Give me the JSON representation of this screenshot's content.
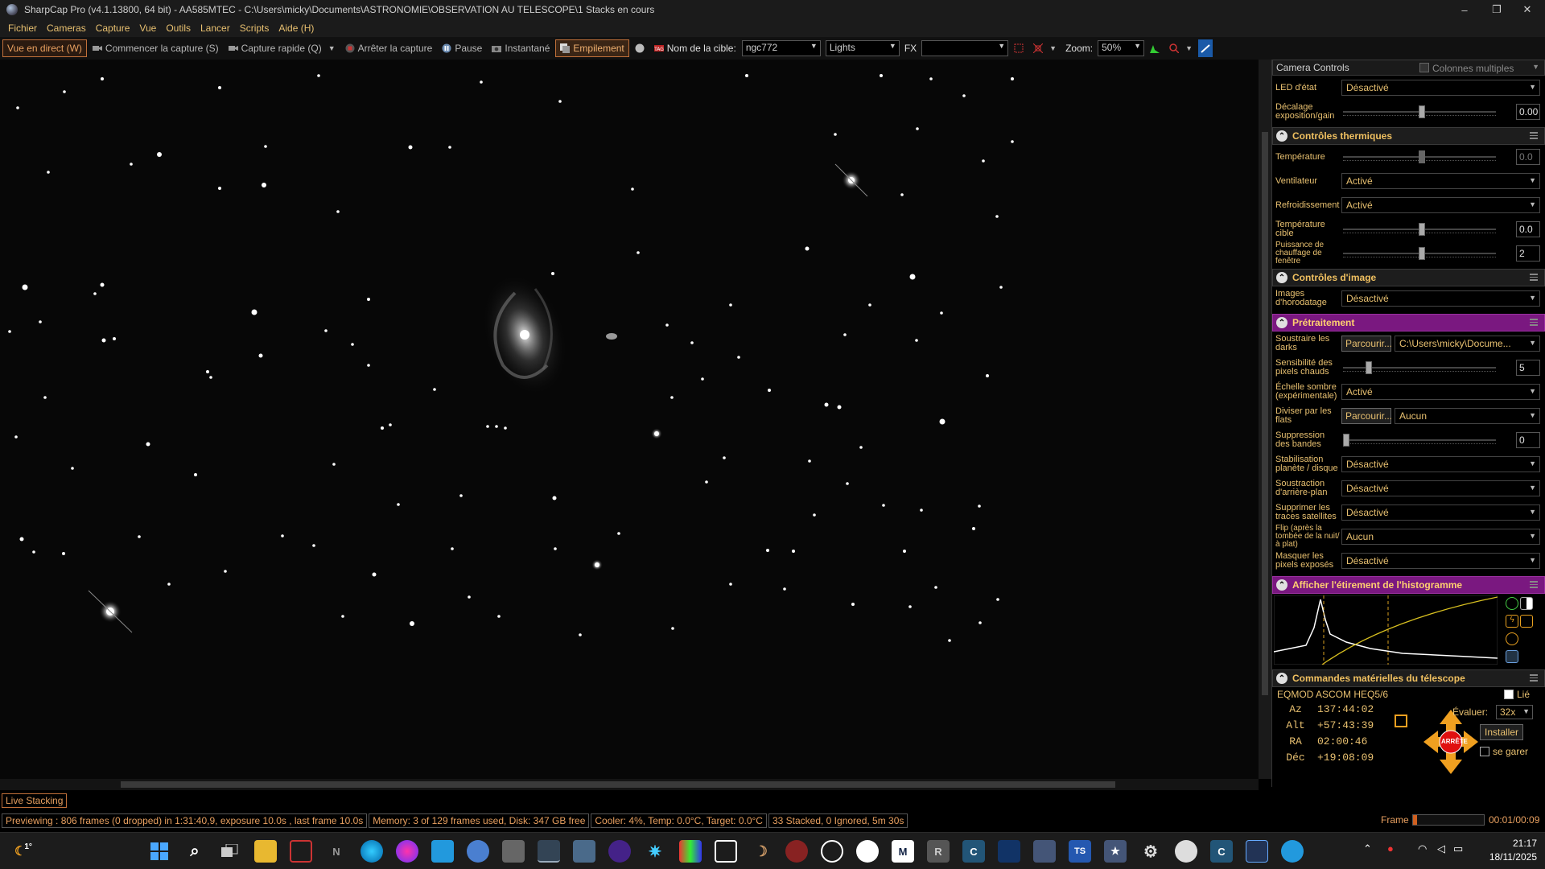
{
  "window": {
    "title": "SharpCap Pro (v4.1.13800, 64 bit) - AA585MTEC - C:\\Users\\micky\\Documents\\ASTRONOMIE\\OBSERVATION AU TELESCOPE\\1 Stacks en cours",
    "minimize": "–",
    "maximize": "❐",
    "close": "✕"
  },
  "menu": [
    "Fichier",
    "Cameras",
    "Capture",
    "Vue",
    "Outils",
    "Lancer",
    "Scripts",
    "Aide (H)"
  ],
  "toolbar": {
    "live_view": "Vue en direct (W)",
    "start_capture": "Commencer la capture (S)",
    "quick_capture": "Capture rapide (Q)",
    "stop_capture": "Arrêter la capture",
    "pause": "Pause",
    "snapshot": "Instantané",
    "stacking": "Empilement",
    "target_label": "Nom de la cible:",
    "target_value": "ngc772",
    "frame_type": "Lights",
    "fx_label": "FX",
    "fx_value": "",
    "zoom_label": "Zoom:",
    "zoom_value": "50%"
  },
  "panel": {
    "header": "Camera Controls",
    "multi_columns": "Colonnes multiples",
    "top_rows": [
      {
        "label": "LED d'état",
        "value": "Désactivé"
      },
      {
        "label": "Décalage exposition/gain",
        "value": "0.00"
      }
    ],
    "thermal": {
      "title": "Contrôles thermiques",
      "temperature": {
        "label": "Température",
        "value": "0.0"
      },
      "fan": {
        "label": "Ventilateur",
        "value": "Activé"
      },
      "cooling": {
        "label": "Refroidissement",
        "value": "Activé"
      },
      "target_temp": {
        "label": "Température cible",
        "value": "0.0"
      },
      "heater": {
        "label": "Puissance de chauffage de fenêtre",
        "value": "2"
      }
    },
    "image": {
      "title": "Contrôles d'image",
      "timestamp": {
        "label": "Images d'horodatage",
        "value": "Désactivé"
      }
    },
    "preprocessing": {
      "title": "Prétraitement",
      "darks": {
        "label": "Soustraire les darks",
        "browse": "Parcourir...",
        "value": "C:\\Users\\micky\\Docume..."
      },
      "hot_pixels": {
        "label": "Sensibilité des pixels chauds",
        "value": "5"
      },
      "dark_scale": {
        "label": "Échelle sombre (expérimentale)",
        "value": "Activé"
      },
      "flats": {
        "label": "Diviser par les flats",
        "browse": "Parcourir...",
        "value": "Aucun"
      },
      "banding": {
        "label": "Suppression des bandes",
        "value": "0"
      },
      "stabilization": {
        "label": "Stabilisation planète / disque",
        "value": "Désactivé"
      },
      "background": {
        "label": "Soustraction d'arrière-plan",
        "value": "Désactivé"
      },
      "satellites": {
        "label": "Supprimer les traces satellites",
        "value": "Désactivé"
      },
      "flip": {
        "label": "Flip (après la tombée de la nuit/à plat)",
        "value": "Aucun"
      },
      "overexposed": {
        "label": "Masquer les pixels exposés",
        "value": "Désactivé"
      }
    },
    "histogram": {
      "title": "Afficher l'étirement de l'histogramme"
    },
    "telescope": {
      "title": "Commandes matérielles du télescope",
      "mount": "EQMOD ASCOM HEQ5/6",
      "linked": "Lié",
      "rows": [
        {
          "label": "Az",
          "value": "137:44:02"
        },
        {
          "label": "Alt",
          "value": "+57:43:39"
        },
        {
          "label": "RA",
          "value": "02:00:46"
        },
        {
          "label": "Déc",
          "value": "+19:08:09"
        }
      ],
      "rate_label": "Évaluer:",
      "rate_value": "32x",
      "install": "Installer",
      "stop": "ARRÊTE",
      "park": "se garer"
    }
  },
  "live_tab": "Live Stacking",
  "status": {
    "preview": "Previewing : 806 frames (0 dropped) in 1:31:40,9, exposure 10.0s , last frame 10.0s",
    "memory": "Memory: 3 of 129 frames used, Disk: 347 GB free",
    "cooler": "Cooler: 4%, Temp: 0.0°C, Target: 0.0°C",
    "stacked": "33 Stacked, 0 Ignored, 5m 30s",
    "frame_label": "Frame :",
    "frame_progress": 0.06,
    "frame_time": "00:01/00:09"
  },
  "taskbar": {
    "time": "21:17",
    "date": "18/11/2025",
    "weather_temp": "1°"
  },
  "colors": {
    "accent_orange": "#e8a060",
    "label_yellow": "#e8c070",
    "section_purple": "#7a1880",
    "stop_red": "#e01010",
    "arrow_orange": "#f0a020"
  }
}
